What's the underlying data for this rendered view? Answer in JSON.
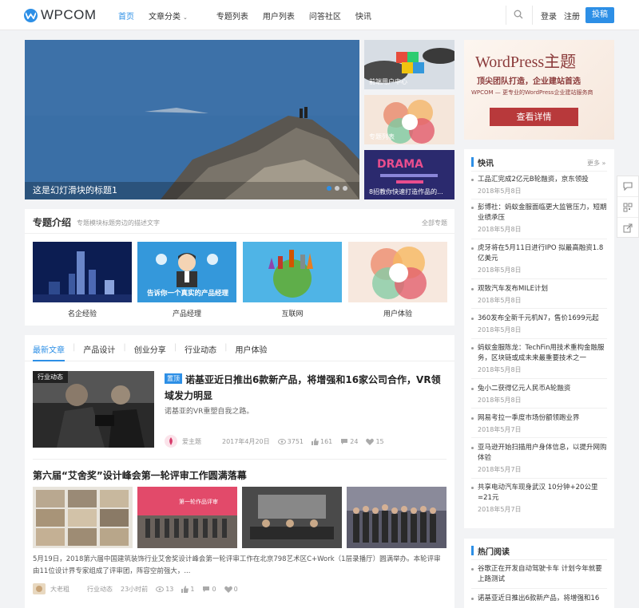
{
  "header": {
    "logo_text": "WPCOM",
    "nav": [
      "首页",
      "文章分类",
      "专题列表",
      "用户列表",
      "问答社区",
      "快讯"
    ],
    "login": "登录",
    "register": "注册",
    "post_button": "投稿",
    "brand_color": "#2d8fe6"
  },
  "slider": {
    "caption": "这是幻灯滑块的标题1",
    "thumbs": [
      "前端用户中心",
      "专题列表",
      "8招教你快速打造作品的..."
    ]
  },
  "ad": {
    "title": "WordPress主题",
    "subtitle": "顶尖团队打造，企业建站首选",
    "desc": "WPCOM — 更专业的WordPress企业建站服务商",
    "button": "查看详情"
  },
  "topics": {
    "title": "专题介绍",
    "desc": "专题模块标题旁边的描述文字",
    "all": "全部专题",
    "cards": [
      "名企经验",
      "产品经理",
      "互联网",
      "用户体验"
    ],
    "card2_banner": "告诉你一个真实的产品经理"
  },
  "tabs": [
    "最新文章",
    "产品设计",
    "创业分享",
    "行业动态",
    "用户体验"
  ],
  "article1": {
    "tag": "行业动态",
    "badge": "置顶",
    "title": "诺基亚近日推出6款新产品，将增强和16家公司合作，VR领域发力明显",
    "desc": "诺基亚的VR重塑自我之路。",
    "author": "爱主题",
    "date": "2017年4月20日",
    "views": "3751",
    "likes": "161",
    "comments": "24",
    "favs": "15"
  },
  "article2": {
    "title": "第六届“艾舍奖”设计峰会第一轮评审工作圆满落幕",
    "banner": "第一轮作品评审",
    "desc": "5月19日，2018第六届中国建筑装饰行业艾舍奖设计峰会第一轮评审工作在北京798艺术区C+Work（1层录播厅）圆满举办。本轮评审由11位设计界专家组成了评审团，阵容空前强大，...",
    "author": "大老粗",
    "category": "行业动态",
    "time": "23小时前",
    "views": "13",
    "likes": "1",
    "comments": "0",
    "favs": "0"
  },
  "sidebar": {
    "news_title": "快讯",
    "more": "更多 »",
    "news": [
      {
        "title": "工品汇完成2亿元B轮融资，京东领投",
        "date": "2018年5月8日"
      },
      {
        "title": "彭博社：蚂蚁金服面临更大监管压力，短期业绩承压",
        "date": "2018年5月8日"
      },
      {
        "title": "虎牙将在5月11日进行IPO 拟最高融资1.8亿美元",
        "date": "2018年5月8日"
      },
      {
        "title": "观致汽车发布MILE计划",
        "date": "2018年5月8日"
      },
      {
        "title": "360发布全新千元机N7，售价1699元起",
        "date": "2018年5月8日"
      },
      {
        "title": "蚂蚁金服陈龙：TechFin用技术重构金融服务，区块链或成未来最重要技术之一",
        "date": "2018年5月8日"
      },
      {
        "title": "兔小二获得亿元人民币A轮融资",
        "date": "2018年5月8日"
      },
      {
        "title": "网易考拉一季度市场份额领跑业界",
        "date": "2018年5月7日"
      },
      {
        "title": "亚马逊开始扫描用户身体信息，以提升网购体验",
        "date": "2018年5月7日"
      },
      {
        "title": "共享电动汽车现身武汉 10分钟+20公里=21元",
        "date": "2018年5月7日"
      }
    ],
    "hot_title": "热门阅读",
    "hot": [
      "谷歌正在开发自动驾驶卡车 计划今年就要上路测试",
      "诺基亚近日推出6款新产品，将增强和16"
    ]
  }
}
